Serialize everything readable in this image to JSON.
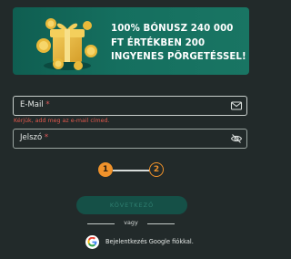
{
  "banner": {
    "headline": "100% BÓNUSZ 240 000 FT ÉRTÉKBEN 200 INGYENES PÖRGETÉSSEL!",
    "art": "gift-box-coins"
  },
  "form": {
    "email_label": "E-Mail",
    "email_icon": "envelope-icon",
    "email_error": "Kérjük, add meg az e-mail címed.",
    "password_label": "Jelszó",
    "password_icon": "eye-slash-icon",
    "required_mark": "*"
  },
  "stepper": {
    "step1": "1",
    "step2": "2",
    "active_step": 1
  },
  "continue_button": "KÖVETKEZŐ",
  "divider": "vagy",
  "google": {
    "label": "Bejelentkezés Google fiókkal.",
    "icon": "google-icon"
  },
  "colors": {
    "background": "#222a2a",
    "banner": "#156f5f",
    "accent": "#f0922b",
    "error": "#e0584c",
    "button": "#155047"
  }
}
